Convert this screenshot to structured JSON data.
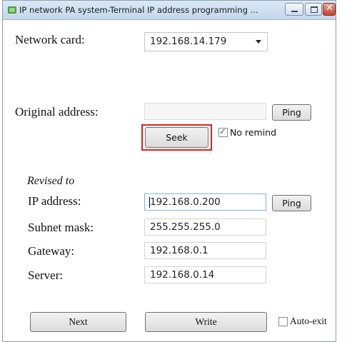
{
  "window": {
    "title": "IP network PA system-Terminal IP address programming ...",
    "controls": {
      "minimize": "minimize",
      "maximize": "maximize",
      "close": "✕"
    }
  },
  "network_card": {
    "label": "Network card:",
    "value": "192.168.14.179"
  },
  "original": {
    "label": "Original address:",
    "value": "",
    "ping_label": "Ping",
    "seek_label": "Seek",
    "no_remind_label": "No remind",
    "no_remind_checked": true
  },
  "revised": {
    "heading": "Revised to",
    "ip_label": "IP address:",
    "ip_value": "192.168.0.200",
    "ping_label": "Ping",
    "subnet_label": "Subnet mask:",
    "subnet_value": "255.255.255.0",
    "gateway_label": "Gateway:",
    "gateway_value": "192.168.0.1",
    "server_label": "Server:",
    "server_value": "192.168.0.14"
  },
  "footer": {
    "next_label": "Next",
    "write_label": "Write",
    "auto_exit_label": "Auto-exit",
    "auto_exit_checked": false
  },
  "colors": {
    "highlight": "#e02020",
    "titlebar": "#c4d7ec",
    "close_button": "#c4422b"
  }
}
